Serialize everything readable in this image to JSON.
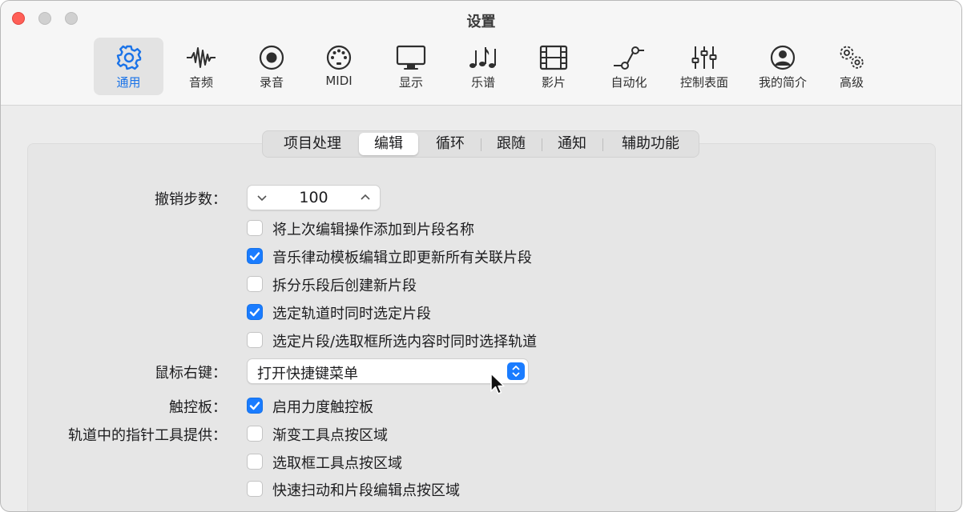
{
  "window": {
    "title": "设置"
  },
  "toolbar": {
    "items": [
      {
        "label": "通用",
        "icon": "gear-icon",
        "active": true
      },
      {
        "label": "音频",
        "icon": "waveform-icon"
      },
      {
        "label": "录音",
        "icon": "record-icon"
      },
      {
        "label": "MIDI",
        "icon": "midi-port-icon"
      },
      {
        "label": "显示",
        "icon": "display-icon"
      },
      {
        "label": "乐谱",
        "icon": "music-notes-icon"
      },
      {
        "label": "影片",
        "icon": "film-icon"
      },
      {
        "label": "自动化",
        "icon": "automation-icon"
      },
      {
        "label": "控制表面",
        "icon": "sliders-icon"
      },
      {
        "label": "我的简介",
        "icon": "profile-icon"
      },
      {
        "label": "高级",
        "icon": "gears-icon"
      }
    ]
  },
  "tabs": [
    {
      "label": "项目处理"
    },
    {
      "label": "编辑",
      "active": true
    },
    {
      "label": "循环"
    },
    {
      "label": "跟随"
    },
    {
      "label": "通知"
    },
    {
      "label": "辅助功能"
    }
  ],
  "undo": {
    "label": "撤销步数：",
    "value": "100"
  },
  "checkboxes_top": [
    {
      "label": "将上次编辑操作添加到片段名称",
      "checked": false
    },
    {
      "label": "音乐律动模板编辑立即更新所有关联片段",
      "checked": true
    },
    {
      "label": "拆分乐段后创建新片段",
      "checked": false
    },
    {
      "label": "选定轨道时同时选定片段",
      "checked": true
    },
    {
      "label": "选定片段/选取框所选内容时同时选择轨道",
      "checked": false
    }
  ],
  "right_click": {
    "label": "鼠标右键：",
    "value": "打开快捷键菜单"
  },
  "trackpad": {
    "label": "触控板：",
    "option": "启用力度触控板",
    "checked": true
  },
  "pointer_tool": {
    "label": "轨道中的指针工具提供：",
    "options": [
      {
        "label": "渐变工具点按区域",
        "checked": false
      },
      {
        "label": "选取框工具点按区域",
        "checked": false
      },
      {
        "label": "快速扫动和片段编辑点按区域",
        "checked": false
      }
    ]
  },
  "colors": {
    "accent": "#1a7cff",
    "close": "#ff5f57"
  }
}
